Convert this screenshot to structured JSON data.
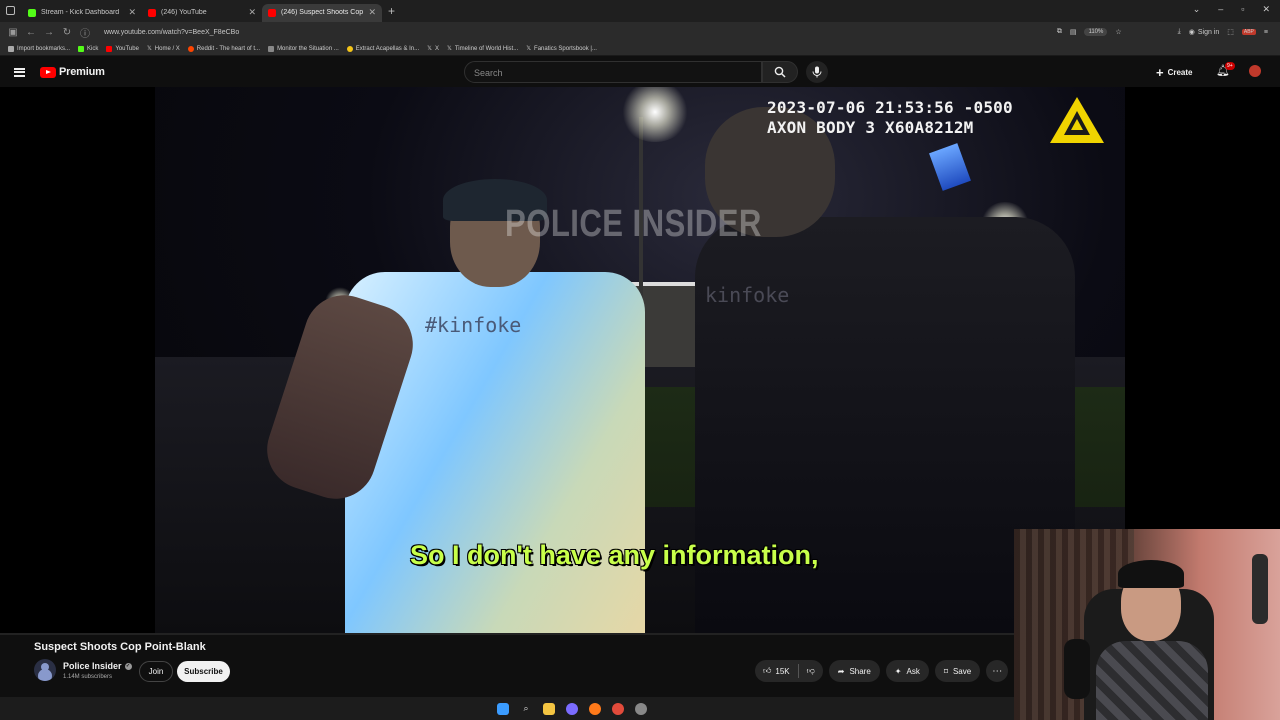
{
  "browser": {
    "tabs": [
      {
        "title": "Stream - Kick Dashboard",
        "favicon_color": "#53fc18",
        "active": false
      },
      {
        "title": "(246) YouTube",
        "favicon_color": "#ff0000",
        "active": false
      },
      {
        "title": "(246) Suspect Shoots Cop P...",
        "favicon_color": "#ff0000",
        "active": true
      }
    ],
    "new_tab": "+",
    "url": "www.youtube.com/watch?v=BeeX_F8eCBo",
    "zoom": "110%",
    "sign_in": "Sign in",
    "bookmarks": [
      {
        "label": "Import bookmarks...",
        "color": "#aaaaaa"
      },
      {
        "label": "Kick",
        "color": "#53fc18"
      },
      {
        "label": "YouTube",
        "color": "#ff0000"
      },
      {
        "label": "Home / X",
        "color": "#ffffff"
      },
      {
        "label": "Reddit - The heart of t...",
        "color": "#ff4500"
      },
      {
        "label": "Monitor the Situation ...",
        "color": "#888888"
      },
      {
        "label": "Extract Acapellas & In...",
        "color": "#f5c518"
      },
      {
        "label": "X",
        "color": "#ffffff"
      },
      {
        "label": "Timeline of World Hist...",
        "color": "#ffffff"
      },
      {
        "label": "Fanatics Sportsbook |...",
        "color": "#ffffff"
      }
    ]
  },
  "youtube": {
    "brand": "Premium",
    "search_placeholder": "Search",
    "create_label": "Create",
    "notification_count": "9+"
  },
  "video": {
    "watermark": "POLICE INSIDER",
    "timestamp_line1": "2023-07-06 21:53:56 -0500",
    "timestamp_line2": "AXON BODY 3 X60A8212M",
    "shirt1_text": "#kinfoke",
    "shirt2_text": "kinfoke",
    "caption": "So I don't have any information,",
    "title": "Suspect Shoots Cop Point-Blank"
  },
  "channel": {
    "name": "Police Insider",
    "subscribers": "1.14M subscribers",
    "join_label": "Join",
    "subscribe_label": "Subscribe"
  },
  "actions": {
    "likes": "15K",
    "share": "Share",
    "ask": "Ask",
    "save": "Save"
  },
  "taskbar_icons": [
    "windows-start-icon",
    "search-icon",
    "file-explorer-icon",
    "app-icon",
    "firefox-icon",
    "chrome-icon",
    "settings-icon"
  ]
}
